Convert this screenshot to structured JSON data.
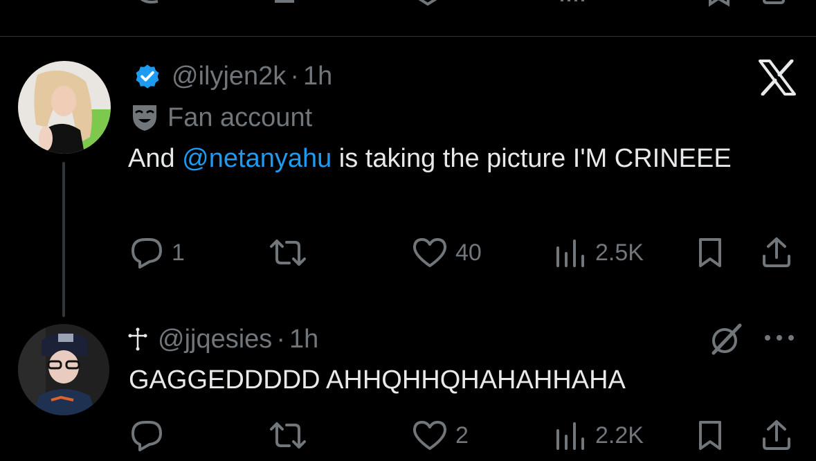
{
  "tweet1": {
    "handle": "@ilyjen2k",
    "separator": "·",
    "time": "1h",
    "label": "Fan account",
    "text_before": "And ",
    "mention": "@netanyahu",
    "text_after": " is taking the picture I'M CRINEEE",
    "replies": "1",
    "retweets": "",
    "likes": "40",
    "views": "2.5K"
  },
  "tweet2": {
    "handle": "@jjqesies",
    "separator": "·",
    "time": "1h",
    "text": "GAGGEDDDDD AHHQHHQHAHAHHAHA",
    "replies": "",
    "retweets": "",
    "likes": "2",
    "views": "2.2K"
  },
  "icons": {
    "verified": "verified-badge-icon",
    "parody": "theater-mask-icon",
    "platform": "x-logo-icon",
    "reply": "reply-icon",
    "retweet": "retweet-icon",
    "like": "heart-icon",
    "views": "views-icon",
    "bookmark": "bookmark-icon",
    "share": "share-icon",
    "grok": "grok-icon",
    "more": "more-icon"
  },
  "colors": {
    "background": "#000000",
    "text": "#e7e9ea",
    "secondary": "#71767b",
    "accent": "#1d9bf0",
    "verified": "#1d9bf0"
  }
}
